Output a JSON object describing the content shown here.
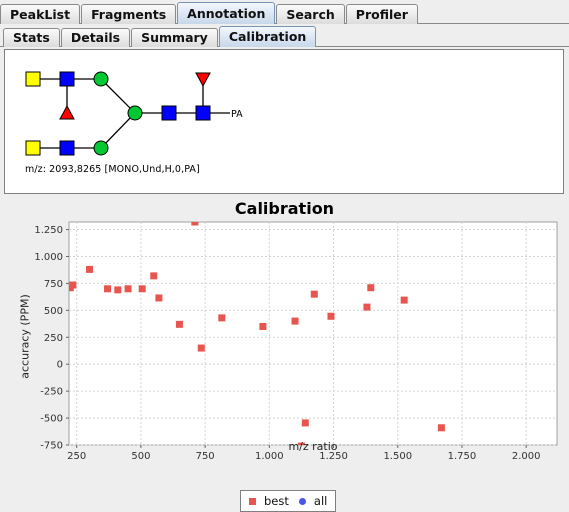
{
  "tabs": {
    "top": [
      "PeakList",
      "Fragments",
      "Annotation",
      "Search",
      "Profiler"
    ],
    "top_active": 2,
    "sub": [
      "Stats",
      "Details",
      "Summary",
      "Calibration"
    ],
    "sub_active": 3
  },
  "glycan": {
    "reducing_end": "PA",
    "mz_text": "m/z: 2093,8265 [MONO,Und,H,0,PA]",
    "colors": {
      "galactose": "#ffff00",
      "glcnac": "#0000ff",
      "mannose": "#00c832",
      "fucose": "#ff0000"
    }
  },
  "chart_data": {
    "type": "scatter",
    "title": "Calibration",
    "xlabel": "m/z ratio",
    "ylabel": "accuracy (PPM)",
    "xlim": [
      220,
      2120
    ],
    "ylim": [
      -750,
      1320
    ],
    "xticks": [
      250,
      500,
      750,
      1000,
      1250,
      1500,
      1750,
      2000
    ],
    "xtick_labels": [
      "250",
      "500",
      "750",
      "1.000",
      "1.250",
      "1.500",
      "1.750",
      "2.000"
    ],
    "yticks": [
      -750,
      -500,
      -250,
      0,
      250,
      500,
      750,
      1000,
      1250
    ],
    "ytick_labels": [
      "-750",
      "-500",
      "-250",
      "0",
      "250",
      "500",
      "750",
      "1.000",
      "1.250"
    ],
    "grid": true,
    "legend_position": "bottom",
    "series": [
      {
        "name": "best",
        "color": "#e8554f",
        "marker": "square",
        "points": [
          [
            225,
            710
          ],
          [
            235,
            735
          ],
          [
            300,
            880
          ],
          [
            370,
            700
          ],
          [
            410,
            690
          ],
          [
            450,
            700
          ],
          [
            505,
            700
          ],
          [
            550,
            820
          ],
          [
            570,
            615
          ],
          [
            650,
            370
          ],
          [
            710,
            1320
          ],
          [
            735,
            150
          ],
          [
            815,
            430
          ],
          [
            975,
            350
          ],
          [
            1100,
            400
          ],
          [
            1125,
            -760
          ],
          [
            1140,
            -545
          ],
          [
            1175,
            650
          ],
          [
            1240,
            445
          ],
          [
            1380,
            530
          ],
          [
            1395,
            710
          ],
          [
            1525,
            595
          ],
          [
            1670,
            -590
          ]
        ]
      },
      {
        "name": "all",
        "color": "#4a56e8",
        "marker": "circle",
        "points": []
      }
    ]
  }
}
